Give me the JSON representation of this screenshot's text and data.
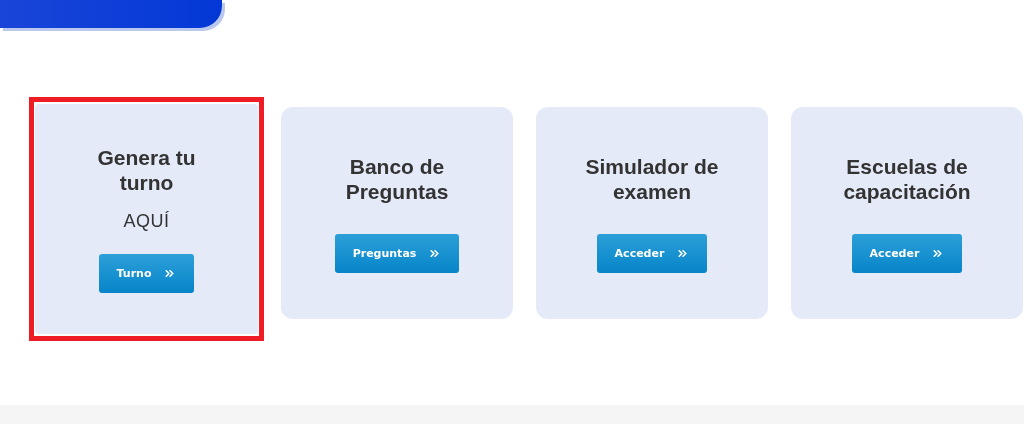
{
  "cards": [
    {
      "title": "Genera tu turno",
      "subtitle": "AQUÍ",
      "button": "Turno",
      "highlighted": true
    },
    {
      "title": "Banco de Preguntas",
      "button": "Preguntas",
      "highlighted": false
    },
    {
      "title": "Simulador de examen",
      "button": "Acceder",
      "highlighted": false
    },
    {
      "title": "Escuelas de capacitación",
      "button": "Acceder",
      "highlighted": false
    }
  ]
}
